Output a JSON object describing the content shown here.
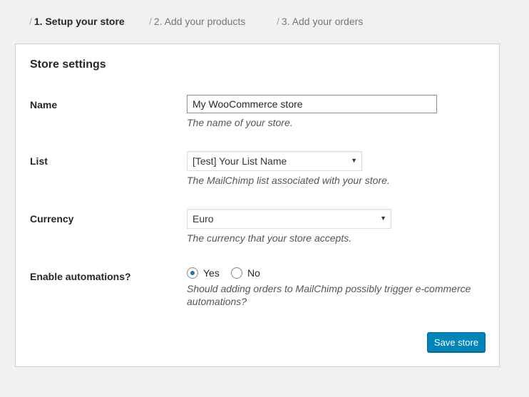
{
  "steps": [
    {
      "sep": "/",
      "label": "1. Setup your store",
      "active": true
    },
    {
      "sep": "/",
      "label": "2. Add your products",
      "active": false
    },
    {
      "sep": "/",
      "label": "3. Add your orders",
      "active": false
    }
  ],
  "card": {
    "title": "Store settings",
    "name": {
      "label": "Name",
      "value": "My WooCommerce store",
      "description": "The name of your store."
    },
    "list": {
      "label": "List",
      "selected": "[Test] Your List Name",
      "description": "The MailChimp list associated with your store."
    },
    "currency": {
      "label": "Currency",
      "selected": "Euro",
      "description": "The currency that your store accepts."
    },
    "automations": {
      "label": "Enable automations?",
      "options": [
        {
          "label": "Yes",
          "checked": true
        },
        {
          "label": "No",
          "checked": false
        }
      ],
      "description_line1": "Should adding orders to MailChimp possibly trigger e-commerce",
      "description_line2": "automations?"
    },
    "save_label": "Save store"
  },
  "colors": {
    "background": "#f1f1f1",
    "primary_button": "#0085ba",
    "radio_checked": "#2271b1"
  },
  "icons": {
    "select_caret": "chevron-down-icon"
  }
}
